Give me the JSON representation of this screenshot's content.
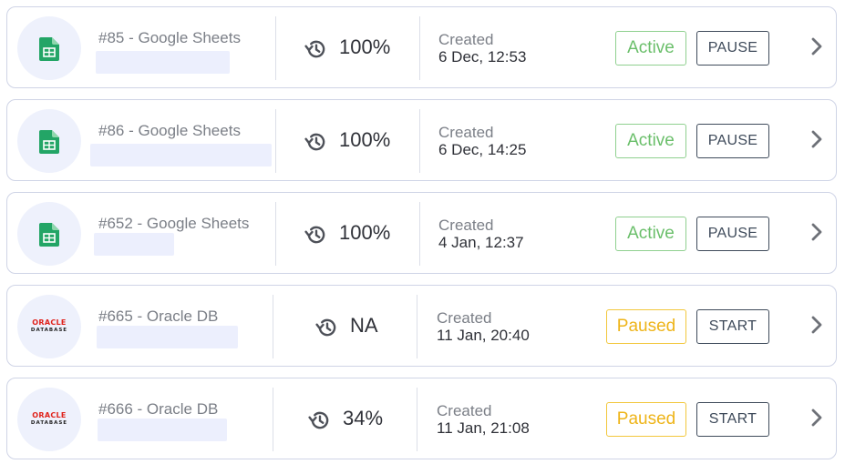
{
  "rows": [
    {
      "id": "85",
      "name": "#85 - Google Sheets",
      "source": "google-sheets",
      "progress": "100%",
      "created_label": "Created",
      "created_date": "6 Dec, 12:53",
      "status": "Active",
      "action": "PAUSE"
    },
    {
      "id": "86",
      "name": "#86 - Google Sheets",
      "source": "google-sheets",
      "progress": "100%",
      "created_label": "Created",
      "created_date": "6 Dec, 14:25",
      "status": "Active",
      "action": "PAUSE"
    },
    {
      "id": "652",
      "name": "#652 - Google Sheets",
      "source": "google-sheets",
      "progress": "100%",
      "created_label": "Created",
      "created_date": "4 Jan, 12:37",
      "status": "Active",
      "action": "PAUSE"
    },
    {
      "id": "665",
      "name": "#665 - Oracle DB",
      "source": "oracle-db",
      "progress": "NA",
      "created_label": "Created",
      "created_date": "11 Jan, 20:40",
      "status": "Paused",
      "action": "START"
    },
    {
      "id": "666",
      "name": "#666 - Oracle DB",
      "source": "oracle-db",
      "progress": "34%",
      "created_label": "Created",
      "created_date": "11 Jan, 21:08",
      "status": "Paused",
      "action": "START"
    }
  ],
  "logos": {
    "oracle_word": "ORACLE",
    "oracle_sub": "DATABASE"
  },
  "icons": {
    "source_google_sheets": "google-sheets-icon",
    "source_oracle": "oracle-database-logo",
    "sync_history": "history-icon",
    "open_details": "chevron-right-icon"
  },
  "colors": {
    "active_text": "#6bbf6b",
    "active_border": "#8fd08f",
    "paused_text": "#eeb419",
    "paused_border": "#f2c73c",
    "button_border": "#3e4a5a",
    "card_border": "#cfd4e6",
    "logo_bg": "#eef1fc",
    "placeholder_bg": "#eceffd",
    "sheets_green": "#23a566",
    "oracle_red": "#e0221b"
  }
}
